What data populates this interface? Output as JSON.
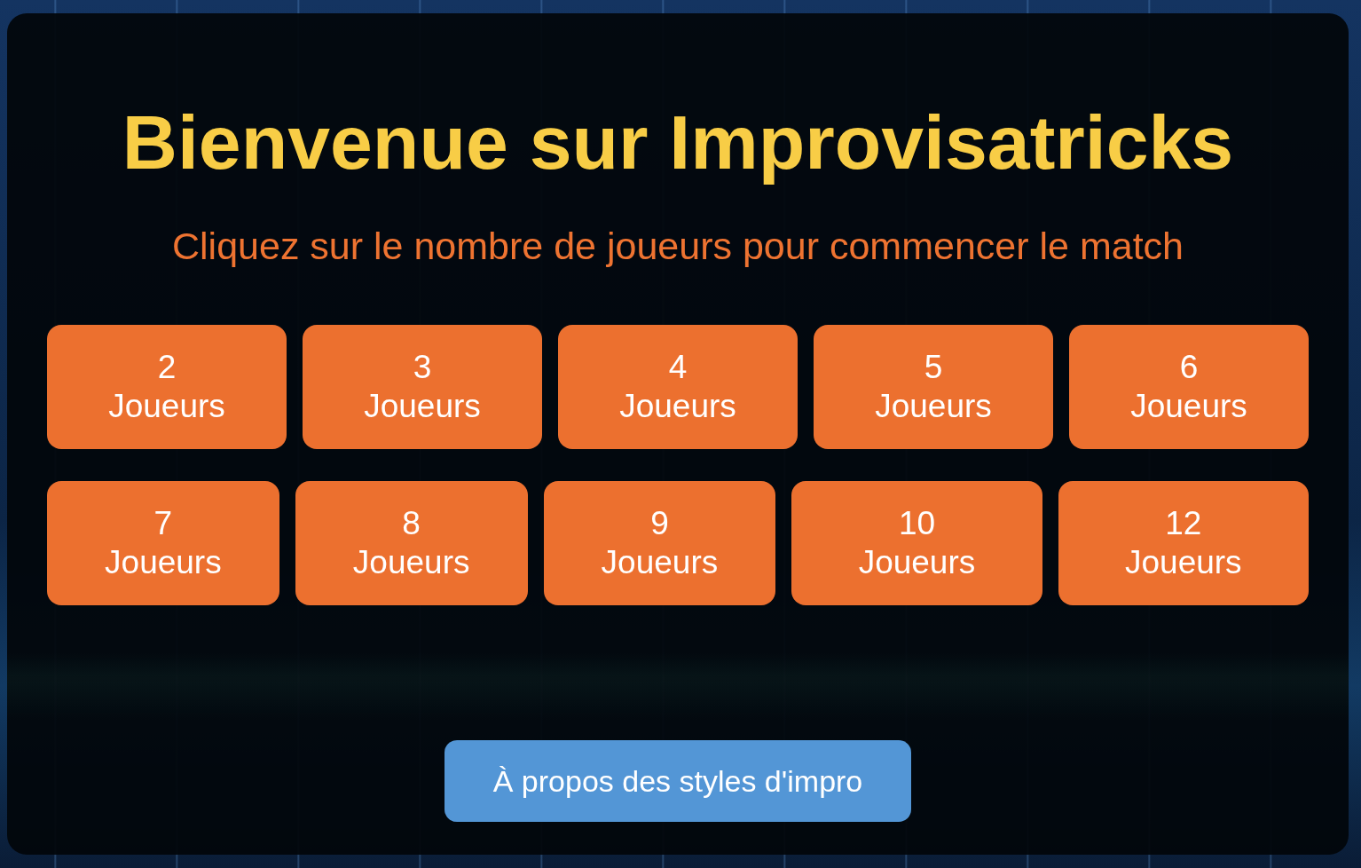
{
  "title": "Bienvenue sur Improvisatricks",
  "subtitle": "Cliquez sur le nombre de joueurs pour commencer le match",
  "player_buttons": [
    {
      "number": "2",
      "label": "Joueurs"
    },
    {
      "number": "3",
      "label": "Joueurs"
    },
    {
      "number": "4",
      "label": "Joueurs"
    },
    {
      "number": "5",
      "label": "Joueurs"
    },
    {
      "number": "6",
      "label": "Joueurs"
    },
    {
      "number": "7",
      "label": "Joueurs"
    },
    {
      "number": "8",
      "label": "Joueurs"
    },
    {
      "number": "9",
      "label": "Joueurs"
    },
    {
      "number": "10",
      "label": "Joueurs"
    },
    {
      "number": "12",
      "label": "Joueurs"
    }
  ],
  "about_button": {
    "label": "À propos des styles d'impro"
  }
}
